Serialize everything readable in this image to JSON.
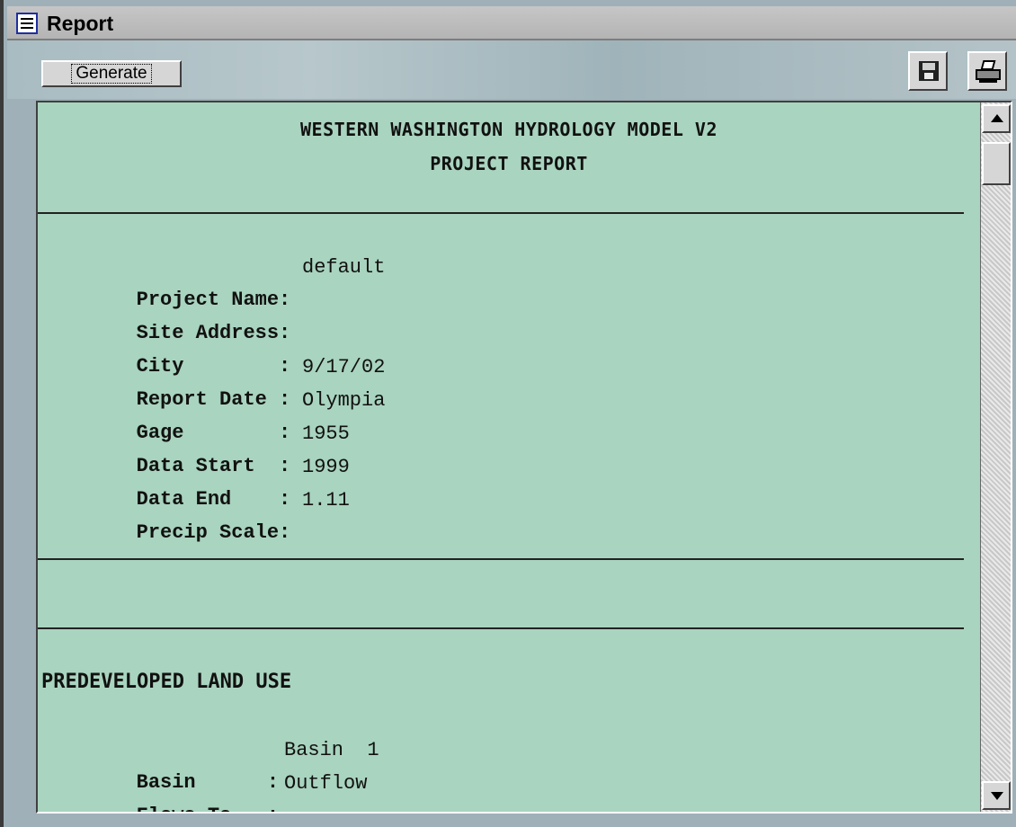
{
  "window": {
    "title": "Report",
    "icon": "document-icon"
  },
  "toolbar": {
    "generate_label": "Generate",
    "save_icon": "floppy-disk-icon",
    "print_icon": "printer-icon"
  },
  "report": {
    "heading1": "WESTERN WASHINGTON HYDROLOGY MODEL V2",
    "heading2": "PROJECT REPORT",
    "fields": [
      {
        "label": "Project Name:",
        "value": "default"
      },
      {
        "label": "Site Address:",
        "value": ""
      },
      {
        "label": "City        :",
        "value": ""
      },
      {
        "label": "Report Date :",
        "value": "9/17/02"
      },
      {
        "label": "Gage        :",
        "value": "Olympia"
      },
      {
        "label": "Data Start  :",
        "value": "1955"
      },
      {
        "label": "Data End    :",
        "value": "1999"
      },
      {
        "label": "Precip Scale:",
        "value": "1.11"
      }
    ],
    "section_title": "PREDEVELOPED LAND USE",
    "basin_fields": [
      {
        "label": "Basin      :",
        "value": "Basin  1"
      },
      {
        "label": "Flows To   :",
        "value": "Outflow"
      }
    ]
  },
  "colors": {
    "report_background": "#a9d4bf",
    "title_icon_border": "#1f2fa0"
  }
}
